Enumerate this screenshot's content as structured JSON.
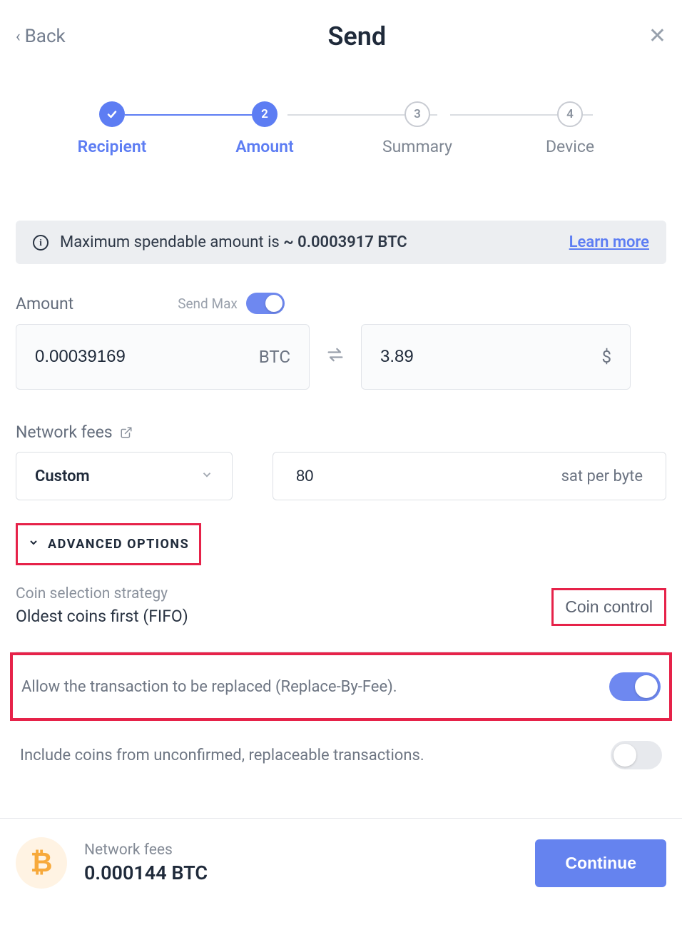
{
  "header": {
    "back_label": "Back",
    "title": "Send"
  },
  "stepper": {
    "steps": [
      {
        "label": "Recipient",
        "state": "done",
        "badge": "check"
      },
      {
        "label": "Amount",
        "state": "active",
        "badge": "2"
      },
      {
        "label": "Summary",
        "state": "pending",
        "badge": "3"
      },
      {
        "label": "Device",
        "state": "pending",
        "badge": "4"
      }
    ]
  },
  "info": {
    "prefix": "Maximum spendable amount is",
    "amount": "~ 0.0003917 BTC",
    "learn_more": "Learn more"
  },
  "amount": {
    "label": "Amount",
    "send_max_label": "Send Max",
    "send_max_on": true,
    "crypto_value": "0.00039169",
    "crypto_unit": "BTC",
    "fiat_value": "3.89",
    "fiat_unit": "$"
  },
  "fees": {
    "label": "Network fees",
    "select_value": "Custom",
    "fee_value": "80",
    "fee_unit": "sat per byte"
  },
  "advanced": {
    "header_label": "ADVANCED OPTIONS",
    "coin_strategy_label": "Coin selection strategy",
    "coin_strategy_value": "Oldest coins first (FIFO)",
    "coin_control_label": "Coin control",
    "rbf_label": "Allow the transaction to be replaced (Replace-By-Fee).",
    "rbf_on": true,
    "unconfirmed_label": "Include coins from unconfirmed, replaceable transactions.",
    "unconfirmed_on": false
  },
  "footer": {
    "fees_label": "Network fees",
    "fees_value": "0.000144 BTC",
    "continue_label": "Continue"
  }
}
